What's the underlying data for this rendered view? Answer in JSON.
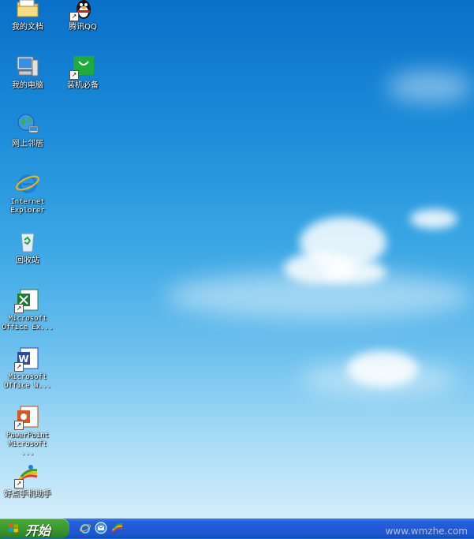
{
  "desktop": {
    "icons": [
      {
        "label": "我的文档"
      },
      {
        "label": "腾讯QQ"
      },
      {
        "label": "我的电脑"
      },
      {
        "label": "装机必备"
      },
      {
        "label": "网上邻居"
      },
      {
        "label": "Internet Explorer"
      },
      {
        "label": "回收站"
      },
      {
        "label": "Microsoft Office Ex..."
      },
      {
        "label": "Microsoft Office W..."
      },
      {
        "label": "PowerPoint Microsoft ..."
      },
      {
        "label": "好点手机助手"
      }
    ]
  },
  "taskbar": {
    "start_label": "开始",
    "quick_launch": [
      "ie-icon",
      "outlook-icon",
      "app-icon"
    ]
  },
  "watermark": "www.wmzhe.com"
}
